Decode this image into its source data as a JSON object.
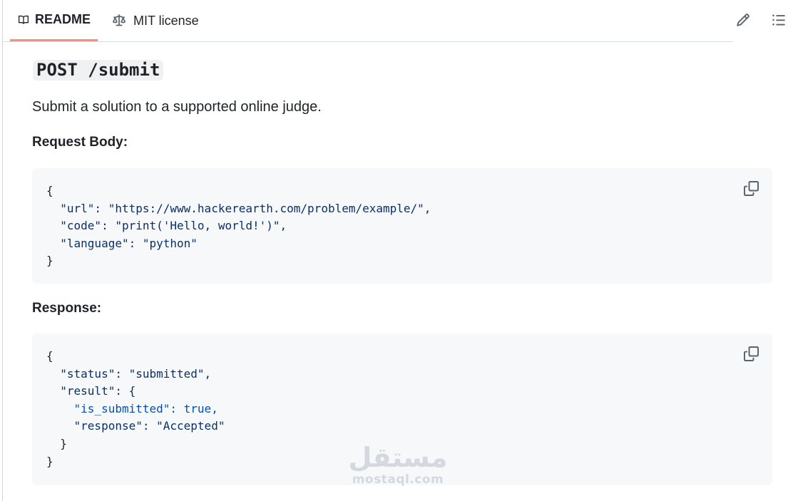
{
  "tabs": [
    {
      "label": "README",
      "icon": "book-icon",
      "active": true
    },
    {
      "label": "MIT license",
      "icon": "scale-icon",
      "active": false
    }
  ],
  "toolbar": {
    "edit_icon": "pencil-icon",
    "toc_icon": "list-icon"
  },
  "endpoint": {
    "method_path": "POST /submit"
  },
  "description": "Submit a solution to a supported online judge.",
  "request": {
    "heading": "Request Body:",
    "lines": [
      "{",
      "  \"url\": \"https://www.hackerearth.com/problem/example/\",",
      "  \"code\": \"print('Hello, world!')\",",
      "  \"language\": \"python\"",
      "}"
    ],
    "copy_icon": "copy-icon"
  },
  "response": {
    "heading": "Response:",
    "lines": [
      "{",
      "  \"status\": \"submitted\",",
      "  \"result\": {",
      "    \"is_submitted\": true,",
      "    \"response\": \"Accepted\"",
      "  }",
      "}"
    ],
    "copy_icon": "copy-icon"
  },
  "watermark": {
    "arabic": "مستقل",
    "latin": "mostaql.com"
  },
  "colors": {
    "active_tab_underline": "#fd8c73",
    "code_bg": "#f6f8fa",
    "json_string": "#0a3069",
    "json_bool": "#0550ae"
  }
}
